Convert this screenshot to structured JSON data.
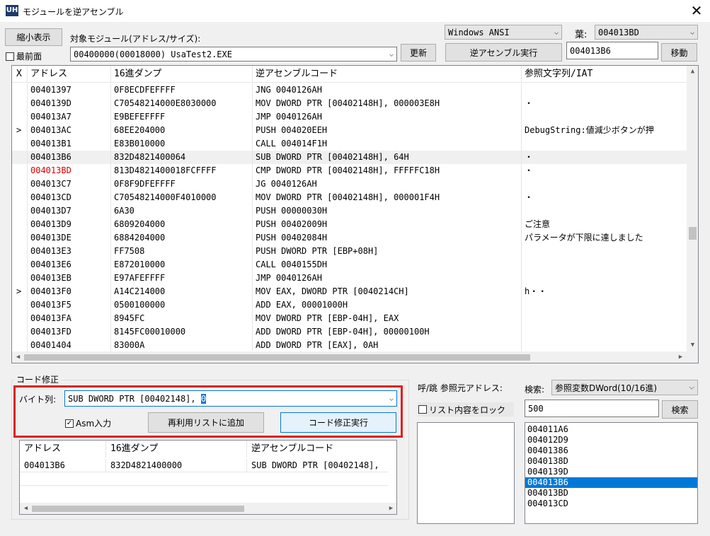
{
  "window": {
    "title": "モジュールを逆アセンブル",
    "icon": "UH",
    "close_glyph": "✕"
  },
  "toolbar": {
    "shrink_button": "縮小表示",
    "topmost_label": "最前面",
    "target_module_label": "対象モジュール(アドレス/サイズ):",
    "module_value": "00400000(00018000) UsaTest2.EXE",
    "refresh_button": "更新",
    "encoding_value": "Windows ANSI",
    "leaf_label": "葉:",
    "leaf_value": "004013BD",
    "disasm_button": "逆アセンブル実行",
    "goto_value": "004013B6",
    "move_button": "移動"
  },
  "grid": {
    "columns": [
      "X",
      "アドレス",
      "16進ダンプ",
      "逆アセンブルコード",
      "参照文字列/IAT"
    ],
    "rows": [
      {
        "x": "",
        "addr": "00401397",
        "dump": "0F8ECDFEFFFF",
        "asm": "JNG 0040126AH",
        "ref": ""
      },
      {
        "x": "",
        "addr": "0040139D",
        "dump": "C70548214000E8030000",
        "asm": "MOV DWORD PTR [00402148H], 000003E8H",
        "ref": "・"
      },
      {
        "x": "",
        "addr": "004013A7",
        "dump": "E9BEFEFFFF",
        "asm": "JMP 0040126AH",
        "ref": ""
      },
      {
        "x": ">",
        "addr": "004013AC",
        "dump": "68EE204000",
        "asm": "PUSH 004020EEH",
        "ref": "DebugString:値減少ボタンが押"
      },
      {
        "x": "",
        "addr": "004013B1",
        "dump": "E83B010000",
        "asm": "CALL 004014F1H",
        "ref": ""
      },
      {
        "x": "",
        "addr": "004013B6",
        "dump": "832D4821400064",
        "asm": "SUB DWORD PTR [00402148H], 64H",
        "ref": "・"
      },
      {
        "x": "",
        "addr": "004013BD",
        "dump": "813D4821400018FCFFFF",
        "asm": "CMP DWORD PTR [00402148H], FFFFFC18H",
        "ref": "・"
      },
      {
        "x": "",
        "addr": "004013C7",
        "dump": "0F8F9DFEFFFF",
        "asm": "JG 0040126AH",
        "ref": ""
      },
      {
        "x": "",
        "addr": "004013CD",
        "dump": "C70548214000F4010000",
        "asm": "MOV DWORD PTR [00402148H], 000001F4H",
        "ref": "・"
      },
      {
        "x": "",
        "addr": "004013D7",
        "dump": "6A30",
        "asm": "PUSH 00000030H",
        "ref": ""
      },
      {
        "x": "",
        "addr": "004013D9",
        "dump": "6809204000",
        "asm": "PUSH 00402009H",
        "ref": "ご注意"
      },
      {
        "x": "",
        "addr": "004013DE",
        "dump": "6884204000",
        "asm": "PUSH 00402084H",
        "ref": "パラメータが下限に達しました"
      },
      {
        "x": "",
        "addr": "004013E3",
        "dump": "FF7508",
        "asm": "PUSH DWORD PTR [EBP+08H]",
        "ref": ""
      },
      {
        "x": "",
        "addr": "004013E6",
        "dump": "E872010000",
        "asm": "CALL 0040155DH",
        "ref": ""
      },
      {
        "x": "",
        "addr": "004013EB",
        "dump": "E97AFEFFFF",
        "asm": "JMP 0040126AH",
        "ref": ""
      },
      {
        "x": ">",
        "addr": "004013F0",
        "dump": "A14C214000",
        "asm": "MOV EAX, DWORD PTR [0040214CH]",
        "ref": "h・・"
      },
      {
        "x": "",
        "addr": "004013F5",
        "dump": "0500100000",
        "asm": "ADD EAX, 00001000H",
        "ref": ""
      },
      {
        "x": "",
        "addr": "004013FA",
        "dump": "8945FC",
        "asm": "MOV DWORD PTR [EBP-04H], EAX",
        "ref": ""
      },
      {
        "x": "",
        "addr": "004013FD",
        "dump": "8145FC00010000",
        "asm": "ADD DWORD PTR [EBP-04H], 00000100H",
        "ref": ""
      },
      {
        "x": "",
        "addr": "00401404",
        "dump": "83000A",
        "asm": "ADD DWORD PTR [EAX], 0AH",
        "ref": ""
      }
    ]
  },
  "code_fix": {
    "group_label": "コード修正",
    "bytes_label": "バイト列:",
    "bytes_value": "SUB DWORD PTR [00402148], ",
    "bytes_caret_value": "0",
    "asm_input_label": "Asm入力",
    "add_reuse_button": "再利用リストに追加",
    "execute_button": "コード修正実行",
    "list_columns": [
      "アドレス",
      "16進ダンプ",
      "逆アセンブルコード"
    ],
    "list_rows": [
      {
        "addr": "004013B6",
        "dump": "832D4821400000",
        "asm": "SUB DWORD PTR [00402148],"
      }
    ]
  },
  "caller": {
    "label": "呼/跳 参照元アドレス:",
    "lock_label": "リスト内容をロック"
  },
  "search": {
    "label": "検索:",
    "mode_value": "参照変数DWord(10/16進)",
    "query_value": "500",
    "search_button": "検索",
    "results": [
      "004011A6",
      "004012D9",
      "00401386",
      "0040138D",
      "0040139D",
      "004013B6",
      "004013BD",
      "004013CD"
    ]
  },
  "icons": {
    "dropdown": "chevron-down-icon",
    "check": "check-icon"
  }
}
